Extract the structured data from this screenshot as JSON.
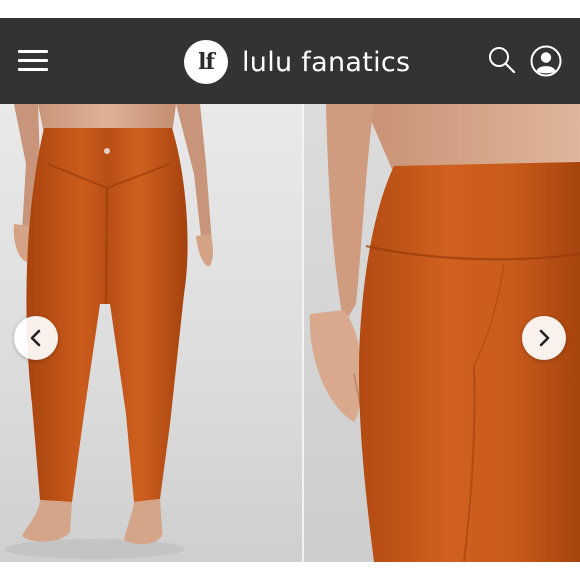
{
  "header": {
    "menu_icon": "hamburger-menu-icon",
    "logo_text": "lf",
    "brand_name": "lulu fanatics",
    "search_icon": "search-icon",
    "account_icon": "user-account-icon",
    "background_color": "#333333"
  },
  "gallery": {
    "images": [
      {
        "description_icon": "leggings-back-view-image"
      },
      {
        "description_icon": "leggings-side-waistband-image"
      }
    ],
    "prev_icon": "chevron-left-icon",
    "next_icon": "chevron-right-icon",
    "product_color": "#c0561b"
  }
}
